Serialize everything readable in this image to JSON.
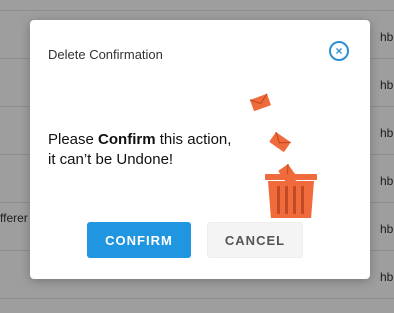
{
  "dialog": {
    "title": "Delete Confirmation",
    "close_icon": "close-circle-icon",
    "message_prefix": "Please ",
    "message_bold": "Confirm",
    "message_suffix": " this action,",
    "message_line2": "it can’t be Undone!",
    "illustration_icon": "trash-can-with-falling-envelopes-icon",
    "confirm_label": "CONFIRM",
    "cancel_label": "CANCEL"
  },
  "background": {
    "right_column_texts": [
      "hb",
      "hb",
      "hb",
      "hb",
      "hb",
      "hb"
    ],
    "left_cut_text": "fferer"
  },
  "colors": {
    "accent": "#2196e0",
    "close_icon": "#2d8fd1",
    "illustration": "#f06b3c",
    "overlay": "rgba(0,0,0,0.38)"
  }
}
